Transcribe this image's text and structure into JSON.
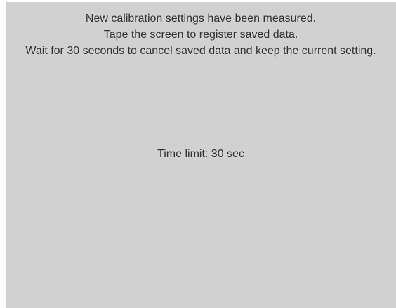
{
  "calibration_prompt": {
    "line1": "New calibration settings have been measured.",
    "line2": "Tape the screen to register saved data.",
    "line3": "Wait for 30 seconds to cancel saved data and keep the current setting."
  },
  "timer": {
    "text": "Time limit: 30 sec"
  },
  "colors": {
    "screen_background": "#d1d1d1",
    "text": "#333333"
  }
}
